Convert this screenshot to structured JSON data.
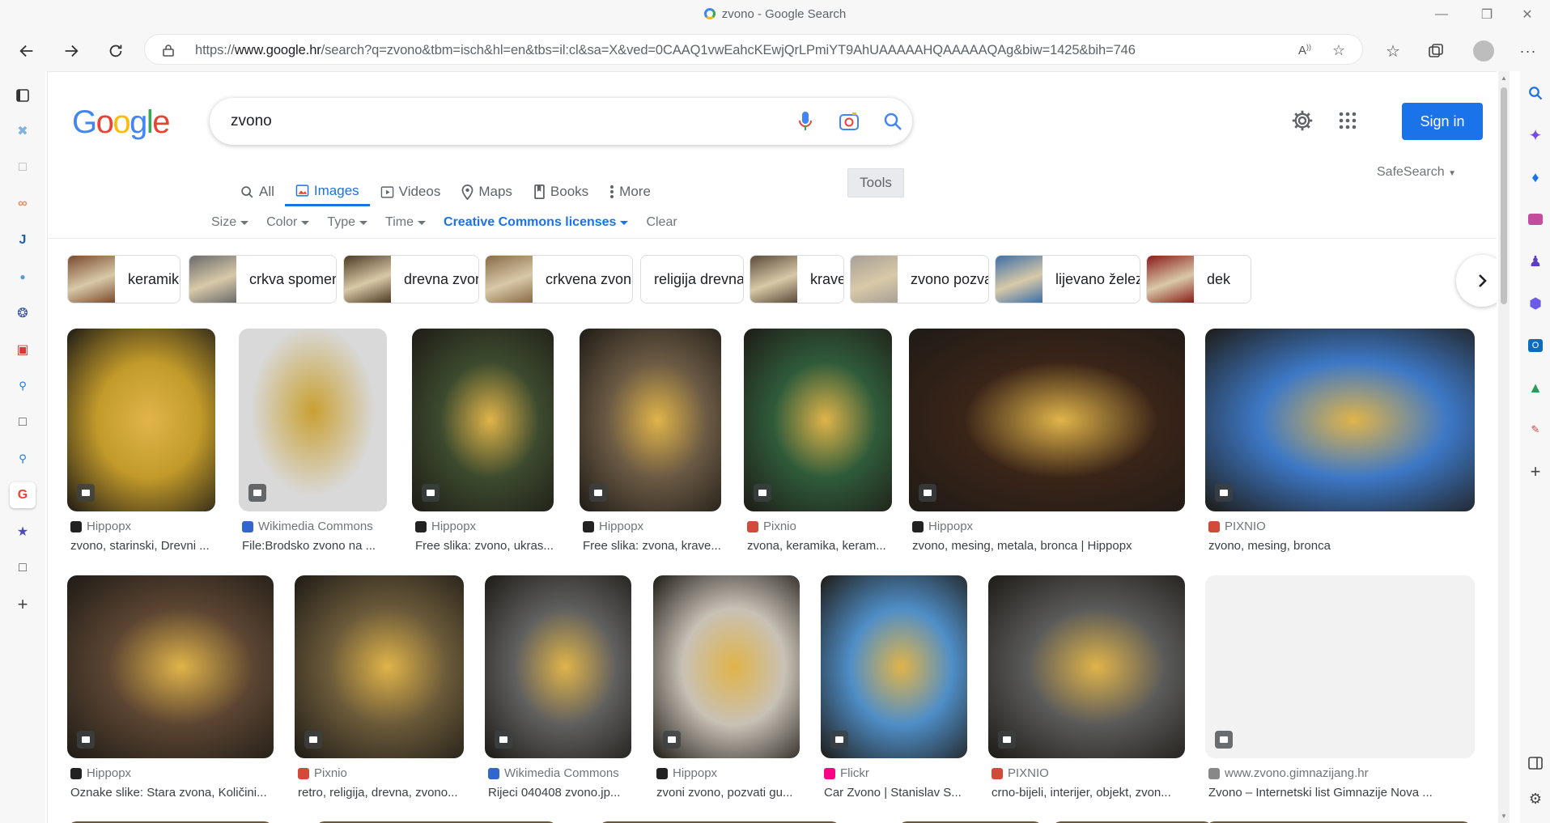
{
  "window": {
    "title": "zvono - Google Search"
  },
  "browser": {
    "url_prefix": "https://",
    "url_host": "www.google.hr",
    "url_rest": "/search?q=zvono&tbm=isch&hl=en&tbs=il:cl&sa=X&ved=0CAAQ1vwEahcKEwjQrLPmiYT9AhUAAAAAHQAAAAAQAg&biw=1425&bih=746"
  },
  "google": {
    "logo_letters": [
      "G",
      "o",
      "o",
      "g",
      "l",
      "e"
    ],
    "logo_colors": [
      "#4285f4",
      "#ea4335",
      "#fbbc05",
      "#4285f4",
      "#34a853",
      "#ea4335"
    ],
    "query": "zvono",
    "sign_in": "Sign in",
    "safesearch": "SafeSearch",
    "tools": "Tools",
    "tabs": [
      {
        "label": "All",
        "icon": "search-icon"
      },
      {
        "label": "Images",
        "icon": "image-icon",
        "active": true
      },
      {
        "label": "Videos",
        "icon": "video-icon"
      },
      {
        "label": "Maps",
        "icon": "map-pin-icon"
      },
      {
        "label": "Books",
        "icon": "book-icon"
      },
      {
        "label": "More",
        "icon": "more-vert-icon"
      }
    ],
    "filters": [
      "Size",
      "Color",
      "Type",
      "Time",
      "Creative Commons licenses"
    ],
    "clear": "Clear"
  },
  "chips": [
    {
      "label": "keramika",
      "color": "#7a4a2e"
    },
    {
      "label": "crkva spomenik",
      "color": "#6b6b6b"
    },
    {
      "label": "drevna zvono",
      "color": "#4d3a22"
    },
    {
      "label": "crkvena zvona",
      "color": "#8a6a48"
    },
    {
      "label": "religija drevna",
      "color": null
    },
    {
      "label": "krave",
      "color": "#5a4a3a"
    },
    {
      "label": "zvono pozvati",
      "color": "#a8a096"
    },
    {
      "label": "lijevano železo",
      "color": "#3d6fa8"
    },
    {
      "label": "dek",
      "color": "#8b1a1a"
    }
  ],
  "results": [
    {
      "source": "Hippopx",
      "title": "zvono, starinski, Drevni ...",
      "bg": "#c29a2a",
      "fav": "#222222"
    },
    {
      "source": "Wikimedia Commons",
      "title": "File:Brodsko zvono na ...",
      "bg": "#d9d9d9",
      "fav": "#3366cc"
    },
    {
      "source": "Hippopx",
      "title": "Free slika: zvono, ukras...",
      "bg": "#3c4a2e",
      "fav": "#222222"
    },
    {
      "source": "Hippopx",
      "title": "Free slika: zvona, krave...",
      "bg": "#6b5a44",
      "fav": "#222222"
    },
    {
      "source": "Pixnio",
      "title": "zvona, keramika, keram...",
      "bg": "#2f5b3a",
      "fav": "#d14a3a"
    },
    {
      "source": "Hippopx",
      "title": "zvono, mesing, metala, bronca | Hippopx",
      "bg": "#3a2418",
      "fav": "#222222"
    },
    {
      "source": "PIXNIO",
      "title": "zvono, mesing, bronca",
      "bg": "#3d78c6",
      "fav": "#d14a3a"
    },
    {
      "source": "Hippopx",
      "title": "Oznake slike: Stara zvona, Količini...",
      "bg": "#5c4532",
      "fav": "#222222"
    },
    {
      "source": "Pixnio",
      "title": "retro, religija, drevna, zvono...",
      "bg": "#6b5a3a",
      "fav": "#d14a3a"
    },
    {
      "source": "Wikimedia Commons",
      "title": "Rijeci 040408 zvono.jp...",
      "bg": "#5f5f5f",
      "fav": "#3366cc"
    },
    {
      "source": "Hippopx",
      "title": "zvoni zvono, pozvati gu...",
      "bg": "#c8c1b6",
      "fav": "#222222"
    },
    {
      "source": "Flickr",
      "title": "Car Zvono | Stanislav S...",
      "bg": "#4f8ec7",
      "fav": "#ff0084"
    },
    {
      "source": "PIXNIO",
      "title": "crno-bijeli, interijer, objekt, zvon...",
      "bg": "#5a5a5a",
      "fav": "#d14a3a"
    },
    {
      "source": "www.zvono.gimnazijang.hr",
      "title": "Zvono – Internetski list Gimnazije Nova ...",
      "bg": "#f2f2f2",
      "fav": "#888888"
    }
  ]
}
